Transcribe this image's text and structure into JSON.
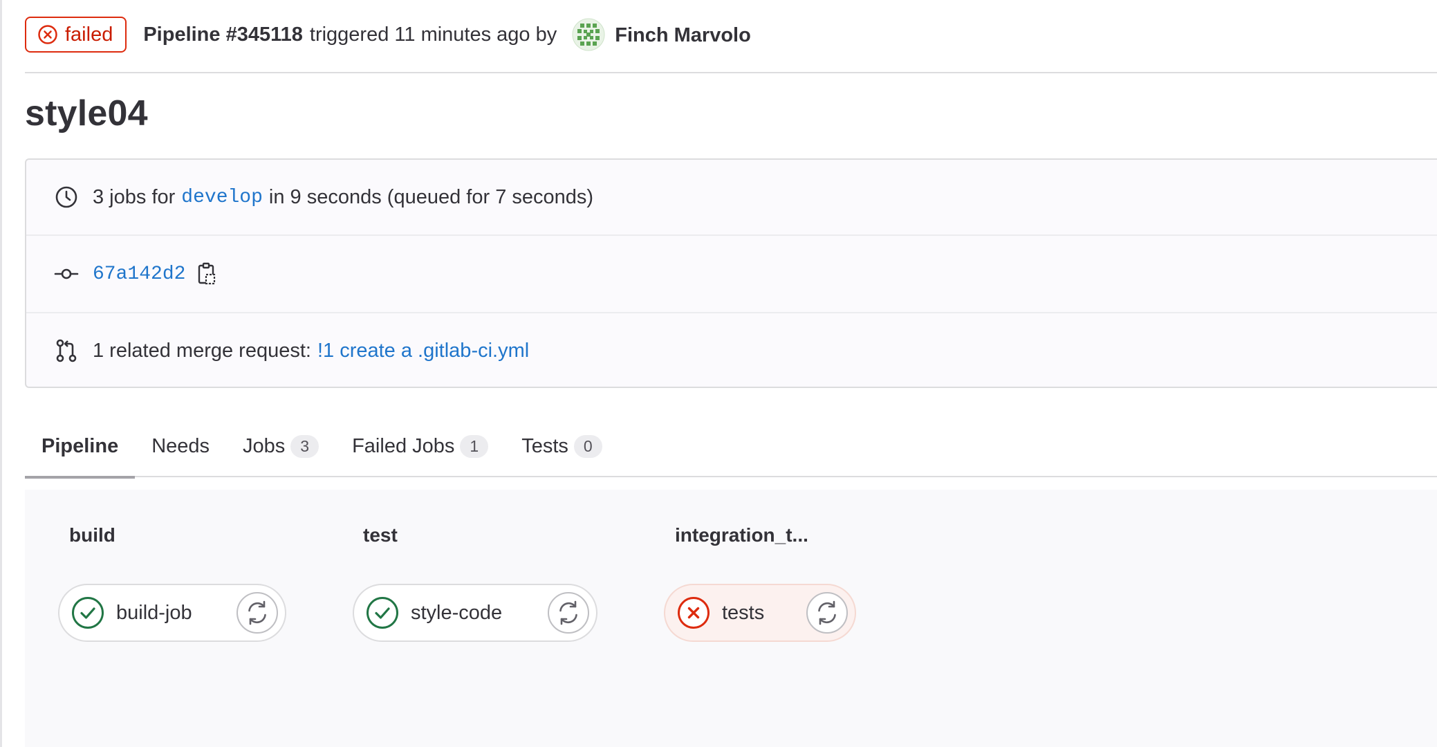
{
  "header": {
    "status": "failed",
    "pipeline_label": "Pipeline #345118",
    "triggered_text": "triggered 11 minutes ago by",
    "user_name": "Finch Marvolo"
  },
  "title": "style04",
  "info": {
    "jobs_prefix": "3 jobs for",
    "branch": "develop",
    "jobs_suffix": "in 9 seconds (queued for 7 seconds)",
    "commit_sha": "67a142d2",
    "mr_prefix": "1 related merge request:",
    "mr_link": "!1 create a .gitlab-ci.yml"
  },
  "tabs": [
    {
      "label": "Pipeline",
      "count": null
    },
    {
      "label": "Needs",
      "count": null
    },
    {
      "label": "Jobs",
      "count": "3"
    },
    {
      "label": "Failed Jobs",
      "count": "1"
    },
    {
      "label": "Tests",
      "count": "0"
    }
  ],
  "stages": [
    {
      "name": "build",
      "job": {
        "name": "build-job",
        "status": "passed"
      }
    },
    {
      "name": "test",
      "job": {
        "name": "style-code",
        "status": "passed"
      }
    },
    {
      "name": "integration_t...",
      "job": {
        "name": "tests",
        "status": "failed"
      }
    }
  ],
  "colors": {
    "failed": "#dd2b0e",
    "passed": "#217645",
    "link": "#1f75cb"
  }
}
